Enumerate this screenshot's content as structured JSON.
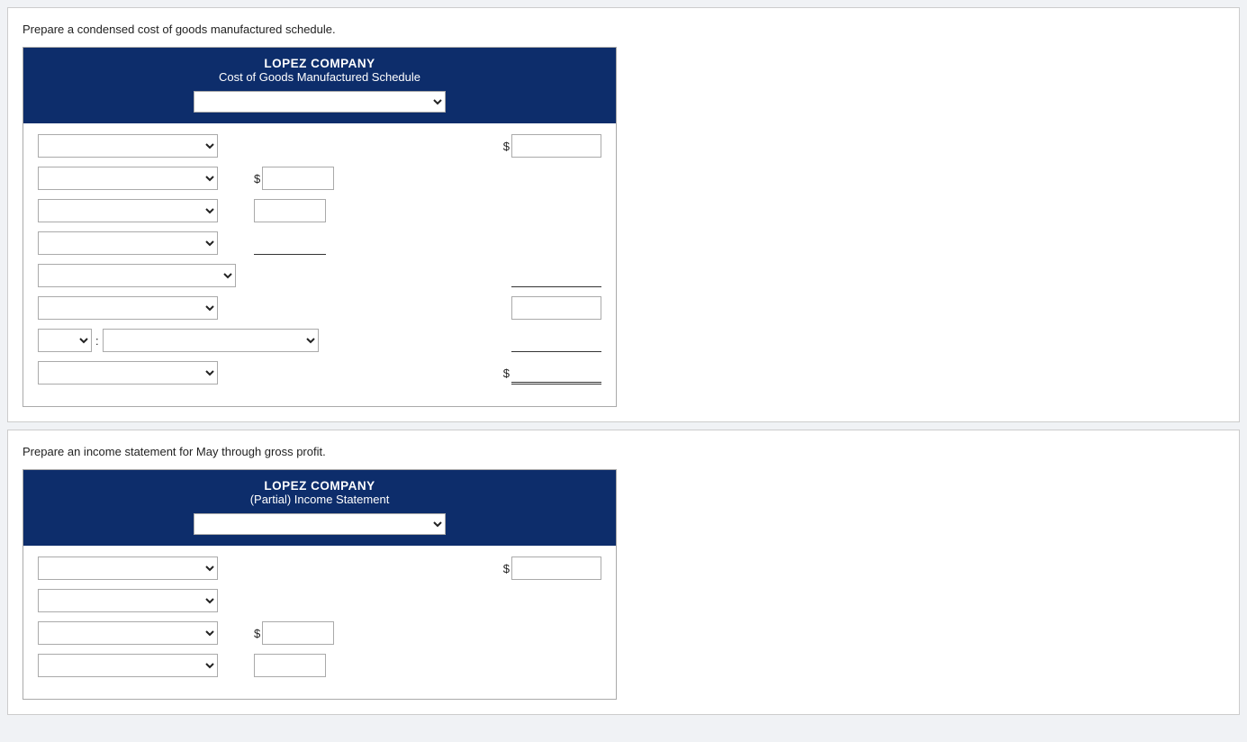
{
  "section1": {
    "instruction": "Prepare a condensed cost of goods manufactured schedule.",
    "header": {
      "company": "LOPEZ COMPANY",
      "title": "Cost of Goods Manufactured Schedule",
      "period_placeholder": ""
    },
    "rows": [
      {
        "id": "row1",
        "type": "label-amount-right",
        "indent": 0
      },
      {
        "id": "row2",
        "type": "label-amount-mid",
        "indent": 0
      },
      {
        "id": "row3",
        "type": "label-amount-mid-only",
        "indent": 0
      },
      {
        "id": "row4",
        "type": "label-amount-mid-only",
        "indent": 0
      },
      {
        "id": "row5",
        "type": "label-amount-right-underlined",
        "indent": 0
      },
      {
        "id": "row6",
        "type": "label-amount-right",
        "indent": 0
      },
      {
        "id": "row7",
        "type": "label-sm-label-amount-right",
        "indent": 0
      },
      {
        "id": "row8",
        "type": "label-amount-right-dollar-double",
        "indent": 0
      }
    ]
  },
  "section2": {
    "instruction": "Prepare an income statement for May through gross profit.",
    "header": {
      "company": "LOPEZ COMPANY",
      "title": "(Partial) Income Statement",
      "period_placeholder": ""
    },
    "rows": [
      {
        "id": "row1",
        "type": "label-amount-right"
      },
      {
        "id": "row2",
        "type": "label-only"
      },
      {
        "id": "row3",
        "type": "label-amount-mid"
      },
      {
        "id": "row4",
        "type": "label-amount-mid-only"
      }
    ]
  },
  "labels": {
    "dollar": "$"
  }
}
